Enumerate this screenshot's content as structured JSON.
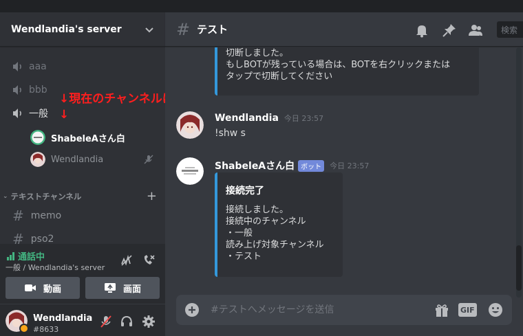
{
  "server": {
    "name": "Wendlandia's server"
  },
  "voice_channels": [
    {
      "name": "aaa"
    },
    {
      "name": "bbb"
    },
    {
      "name": "一般"
    }
  ],
  "annotation": {
    "text": "↓現在のチャンネルに接続",
    "arrow": "↓"
  },
  "voice_users": [
    {
      "name": "ShabeleAさん白"
    },
    {
      "name": "Wendlandia"
    }
  ],
  "text_category": {
    "label": "テキストチャンネル"
  },
  "text_channels": [
    {
      "name": "memo"
    },
    {
      "name": "pso2"
    }
  ],
  "voice_connection": {
    "status": "通話中",
    "location": "一般 / Wendlandia's server",
    "video_label": "動画",
    "screen_label": "画面"
  },
  "user": {
    "name": "Wendlandia",
    "tag": "#8633"
  },
  "channel": {
    "name": "テスト",
    "search_placeholder": "検索"
  },
  "messages": [
    {
      "embed_text": "切断しました。\nもしBOTが残っている場合は、BOTを右クリックまたは\nタップで切断してください"
    },
    {
      "author": "Wendlandia",
      "time": "今日 23:57",
      "text": "!shw s"
    },
    {
      "author": "ShabeleAさん白",
      "bot_tag": "ボット",
      "time": "今日 23:57",
      "embed_title": "接続完了",
      "embed_text": "接続しました。\n接続中のチャンネル\n・一般\n読み上げ対象チャンネル\n・テスト"
    }
  ],
  "composer": {
    "placeholder": "#テストへメッセージを送信",
    "gif_label": "GIF"
  },
  "colors": {
    "accent": "#7289da",
    "embed_border": "#3498db",
    "voice_connected": "#43b581",
    "annotation": "#ff1e1e",
    "idle": "#faa61a"
  }
}
